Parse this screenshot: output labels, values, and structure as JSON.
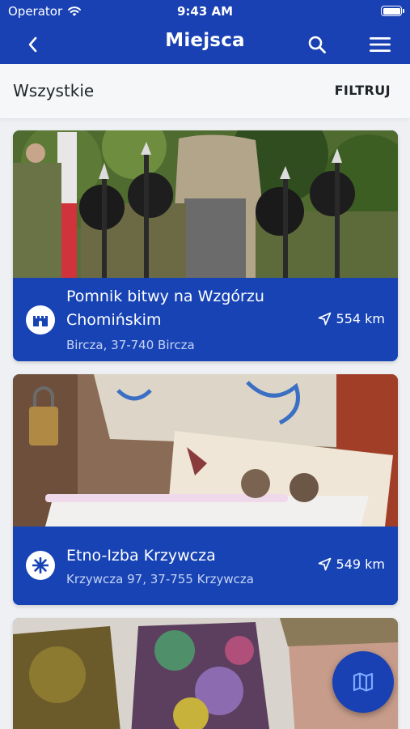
{
  "status_bar": {
    "carrier": "Operator",
    "time": "9:43 AM"
  },
  "nav": {
    "title": "Miejsca"
  },
  "filter_bar": {
    "all_label": "Wszystkie",
    "filter_label": "FILTRUJ"
  },
  "places": [
    {
      "name": "Pomnik bitwy na Wzgórzu Chomińskim",
      "address": "Bircza, 37-740 Bircza",
      "distance": "554 km",
      "category_icon": "castle-icon"
    },
    {
      "name": "Etno-Izba Krzywcza",
      "address": "Krzywcza 97, 37-755 Krzywcza",
      "distance": "549 km",
      "category_icon": "sparkle-icon"
    }
  ],
  "colors": {
    "primary": "#1941b3",
    "card_blue": "#1743b4",
    "background": "#eef0f3"
  }
}
